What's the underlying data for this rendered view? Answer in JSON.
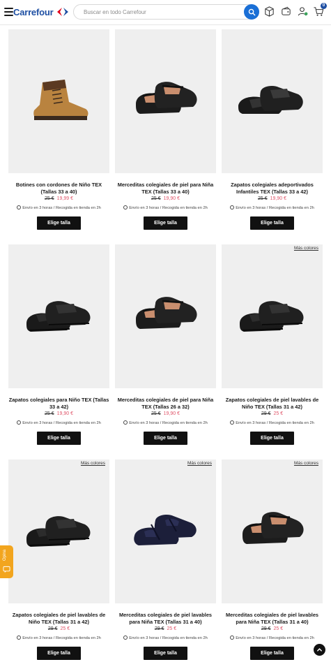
{
  "header": {
    "brand": "Carrefour",
    "search_placeholder": "Buscar en todo Carrefour",
    "cart_count": "0",
    "icons": [
      "menu-icon",
      "carrefour-logo",
      "search-icon",
      "box-icon",
      "wallet-icon",
      "user-icon",
      "cart-icon"
    ]
  },
  "colors": {
    "brand_blue": "#1e4fa3",
    "sale_red": "#e0566a",
    "search_blue": "#1a6fd6",
    "button_black": "#111111",
    "feedback_orange": "#f2a51e"
  },
  "products": [
    {
      "title": "Botines con cordones de Niño TEX (Tallas 33 a 40)",
      "old_price": "25 €",
      "new_price": "19,99 €",
      "delivery": "Envío en 3 horas / Recogida en tienda en 2h",
      "button": "Elige talla",
      "more_colors": "",
      "kind": "boot"
    },
    {
      "title": "Merceditas colegiales de piel para Niña TEX (Tallas 33 a 40)",
      "old_price": "25 €",
      "new_price": "19,90 €",
      "delivery": "Envío en 3 horas / Recogida en tienda en 2h",
      "button": "Elige talla",
      "more_colors": "",
      "kind": "mary"
    },
    {
      "title": "Zapatos colegiales adeportivados Infantiles TEX (Tallas 33 a 42)",
      "old_price": "25 €",
      "new_price": "19,90 €",
      "delivery": "Envío en 3 horas / Recogida en tienda en 2h",
      "button": "Elige talla",
      "more_colors": "",
      "kind": "velcro2"
    },
    {
      "title": "Zapatos colegiales para Niño TEX (Tallas 33 a 42)",
      "old_price": "25 €",
      "new_price": "19,90 €",
      "delivery": "Envío en 3 horas / Recogida en tienda en 2h",
      "button": "Elige talla",
      "more_colors": "",
      "kind": "velcro"
    },
    {
      "title": "Merceditas colegiales de piel para Niña TEX (Tallas 26 a 32)",
      "old_price": "25 €",
      "new_price": "19,90 €",
      "delivery": "Envío en 3 horas / Recogida en tienda en 2h",
      "button": "Elige talla",
      "more_colors": "",
      "kind": "mary"
    },
    {
      "title": "Zapatos colegiales de piel lavables de Niño TEX (Tallas 31 a 42)",
      "old_price": "29 €",
      "new_price": "25 €",
      "delivery": "Envío en 3 horas / Recogida en tienda en 2h",
      "button": "Elige talla",
      "more_colors": "Más colores",
      "kind": "velcro"
    },
    {
      "title": "Zapatos colegiales de piel lavables de Niño TEX (Tallas 31 a 42)",
      "old_price": "29 €",
      "new_price": "25 €",
      "delivery": "Envío en 3 horas / Recogida en tienda en 2h",
      "button": "Elige talla",
      "more_colors": "Más colores",
      "kind": "velcro"
    },
    {
      "title": "Merceditas colegiales de piel lavables para Niña TEX (Tallas 31 a 40)",
      "old_price": "29 €",
      "new_price": "25 €",
      "delivery": "Envío en 3 horas / Recogida en tienda en 2h",
      "button": "Elige talla",
      "more_colors": "Más colores",
      "kind": "mary-navy"
    },
    {
      "title": "Merceditas colegiales de piel lavables para Niña TEX (Tallas 31 a 40)",
      "old_price": "29 €",
      "new_price": "25 €",
      "delivery": "Envío en 3 horas / Recogida en tienda en 2h",
      "button": "Elige talla",
      "more_colors": "Más colores",
      "kind": "mary"
    }
  ],
  "feedback_tab": "Opina",
  "scroll_top_icon": "chevron-up-icon"
}
